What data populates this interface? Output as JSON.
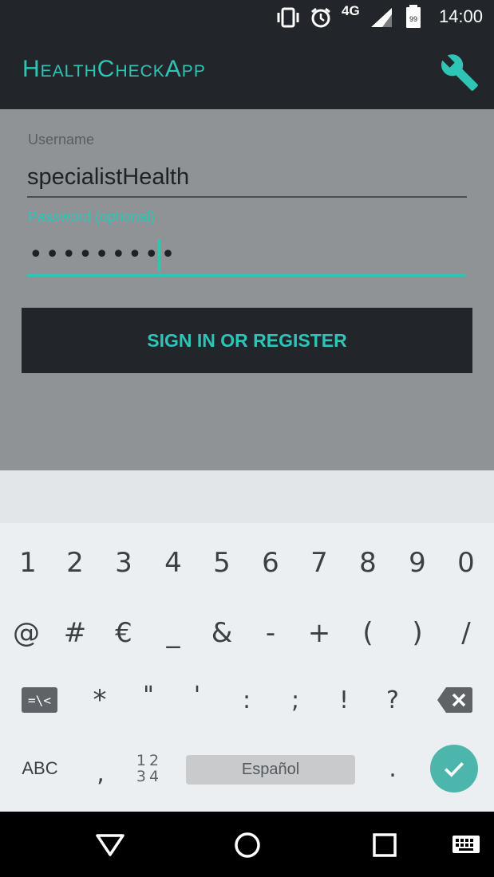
{
  "status_bar": {
    "network": "4G",
    "battery": "99",
    "time": "14:00",
    "icons": [
      "vibrate-icon",
      "alarm-icon",
      "signal-icon",
      "battery-icon"
    ]
  },
  "app_bar": {
    "title": "HealthCheckApp",
    "settings_icon": "wrench-icon"
  },
  "form": {
    "username_label": "Username",
    "username_value": "specialistHealth",
    "password_label": "Password (optional)",
    "password_value": "•••••••••",
    "submit_label": "SIGN IN OR REGISTER"
  },
  "keyboard": {
    "row1": [
      "1",
      "2",
      "3",
      "4",
      "5",
      "6",
      "7",
      "8",
      "9",
      "0"
    ],
    "row2": [
      "@",
      "#",
      "€",
      "_",
      "&",
      "-",
      "+",
      "(",
      ")",
      "/"
    ],
    "row3": [
      "*",
      "\"",
      "'",
      ":",
      ";",
      "!",
      "?"
    ],
    "symbols_key": "=\\<",
    "abc_key": "ABC",
    "comma_key": ",",
    "numpad_key_top": "12",
    "numpad_key_bottom": "34",
    "space_label": "Español",
    "period_key": "."
  },
  "nav_bar": {
    "icons": [
      "back-icon",
      "home-icon",
      "recents-icon",
      "keyboard-switch-icon"
    ]
  },
  "colors": {
    "accent": "#2ec4b6",
    "bar": "#22262b",
    "background": "#909396",
    "keyboard": "#eceff1",
    "enter": "#4db6ac"
  }
}
